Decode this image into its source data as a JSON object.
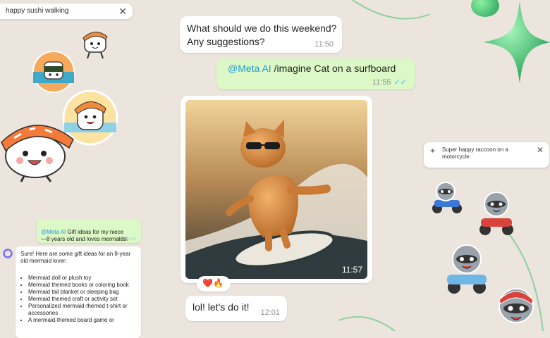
{
  "search_chip": {
    "text": "happy sushi walking",
    "close": "✕"
  },
  "chat": {
    "msg1": {
      "text": "What should we do this weekend?\nAny suggestions?",
      "time": "11:50"
    },
    "msg2": {
      "mention": "@Meta AI",
      "text": "/imagine Cat on a surfboard",
      "time": "11:55",
      "ticks": "✓✓"
    },
    "image": {
      "time": "11:57",
      "reactions": "❤️🔥"
    },
    "msg3": {
      "text": "lol! let's do it!",
      "time": "12:01"
    }
  },
  "raccoon_chip": {
    "text": "Super happy raccoon on a\nmotorcycle",
    "close": "✕"
  },
  "mini_chat": {
    "user_msg": {
      "mention": "@Meta AI",
      "text": " Gift ideas for my niece\n—8 years old and loves mermaids.",
      "time": "12:29",
      "ticks": "✓✓"
    },
    "ai_msg": {
      "intro": "Sure! Here are some gift ideas for an 8-year\nold mermaid lover:",
      "items": [
        "Mermaid doll or plush toy",
        "Mermaid themed books or coloring book",
        "Mermaid tail blanket or sleeping bag",
        "Mermaid themed craft or activity set",
        "Personalized mermaid-themed t-shirt or accessories",
        "A mermaid-themed board game or"
      ]
    }
  },
  "colors": {
    "bubble_green": "#dcf8c6",
    "background": "#ebe5dd",
    "mention": "#1f9bd8",
    "ticks": "#53bdeb"
  }
}
